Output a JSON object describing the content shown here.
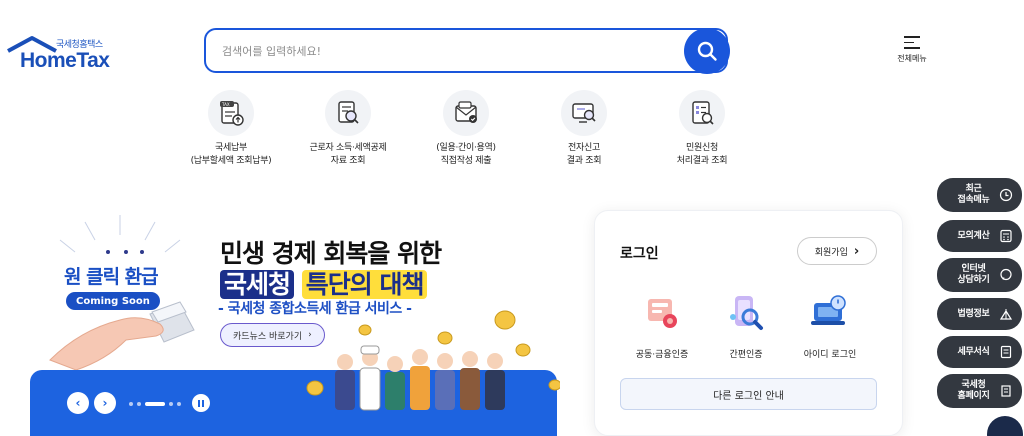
{
  "header": {
    "logo_sub": "국세청홈택스",
    "logo_main": "HomeTax",
    "search_placeholder": "검색어를 입력하세요!",
    "search_icon": "search-icon",
    "all_menu_label": "전체메뉴"
  },
  "quick_menu": [
    {
      "line1": "국세납부",
      "line2": "(납부할세액 조회납부)",
      "icon": "tax-payment-icon"
    },
    {
      "line1": "근로자 소득·세액공제",
      "line2": "자료 조회",
      "icon": "document-search-icon"
    },
    {
      "line1": "(일용·간이·용역)",
      "line2": "직접작성 제출",
      "icon": "tax-envelope-icon"
    },
    {
      "line1": "전자신고",
      "line2": "결과 조회",
      "icon": "monitor-search-icon"
    },
    {
      "line1": "민원신청",
      "line2": "처리결과 조회",
      "icon": "report-search-icon"
    }
  ],
  "banner": {
    "oneclick": "원 클릭 환급",
    "coming_soon": "Coming Soon",
    "headline1": "민생 경제 회복을 위한",
    "headline2_a": "국세청",
    "headline2_b": "특단의 대책",
    "headline3": "- 국세청 종합소득세 환급 서비스 -",
    "cardnews_label": "카드뉴스 바로가기",
    "prev_label": "‹",
    "next_label": "›"
  },
  "login": {
    "title": "로그인",
    "signup_label": "회원가입",
    "options": [
      {
        "label": "공동·금융인증",
        "icon": "certificate-icon"
      },
      {
        "label": "간편인증",
        "icon": "mobile-auth-icon"
      },
      {
        "label": "아이디 로그인",
        "icon": "id-login-icon"
      }
    ],
    "other_login_label": "다른 로그인 안내"
  },
  "side_menu": [
    {
      "label1": "최근",
      "label2": "접속메뉴",
      "icon": "clock-icon"
    },
    {
      "label1": "모의계산",
      "label2": "",
      "icon": "calculator-icon"
    },
    {
      "label1": "인터넷",
      "label2": "상담하기",
      "icon": "chat-icon"
    },
    {
      "label1": "법령정보",
      "label2": "",
      "icon": "law-icon"
    },
    {
      "label1": "세무서식",
      "label2": "",
      "icon": "form-icon"
    },
    {
      "label1": "국세청",
      "label2": "홈페이지",
      "icon": "building-icon"
    }
  ],
  "colors": {
    "primary": "#1a56db",
    "banner_blue": "#1d63e0",
    "side_dark": "#333840",
    "logo_blue": "#1a4fb8"
  }
}
